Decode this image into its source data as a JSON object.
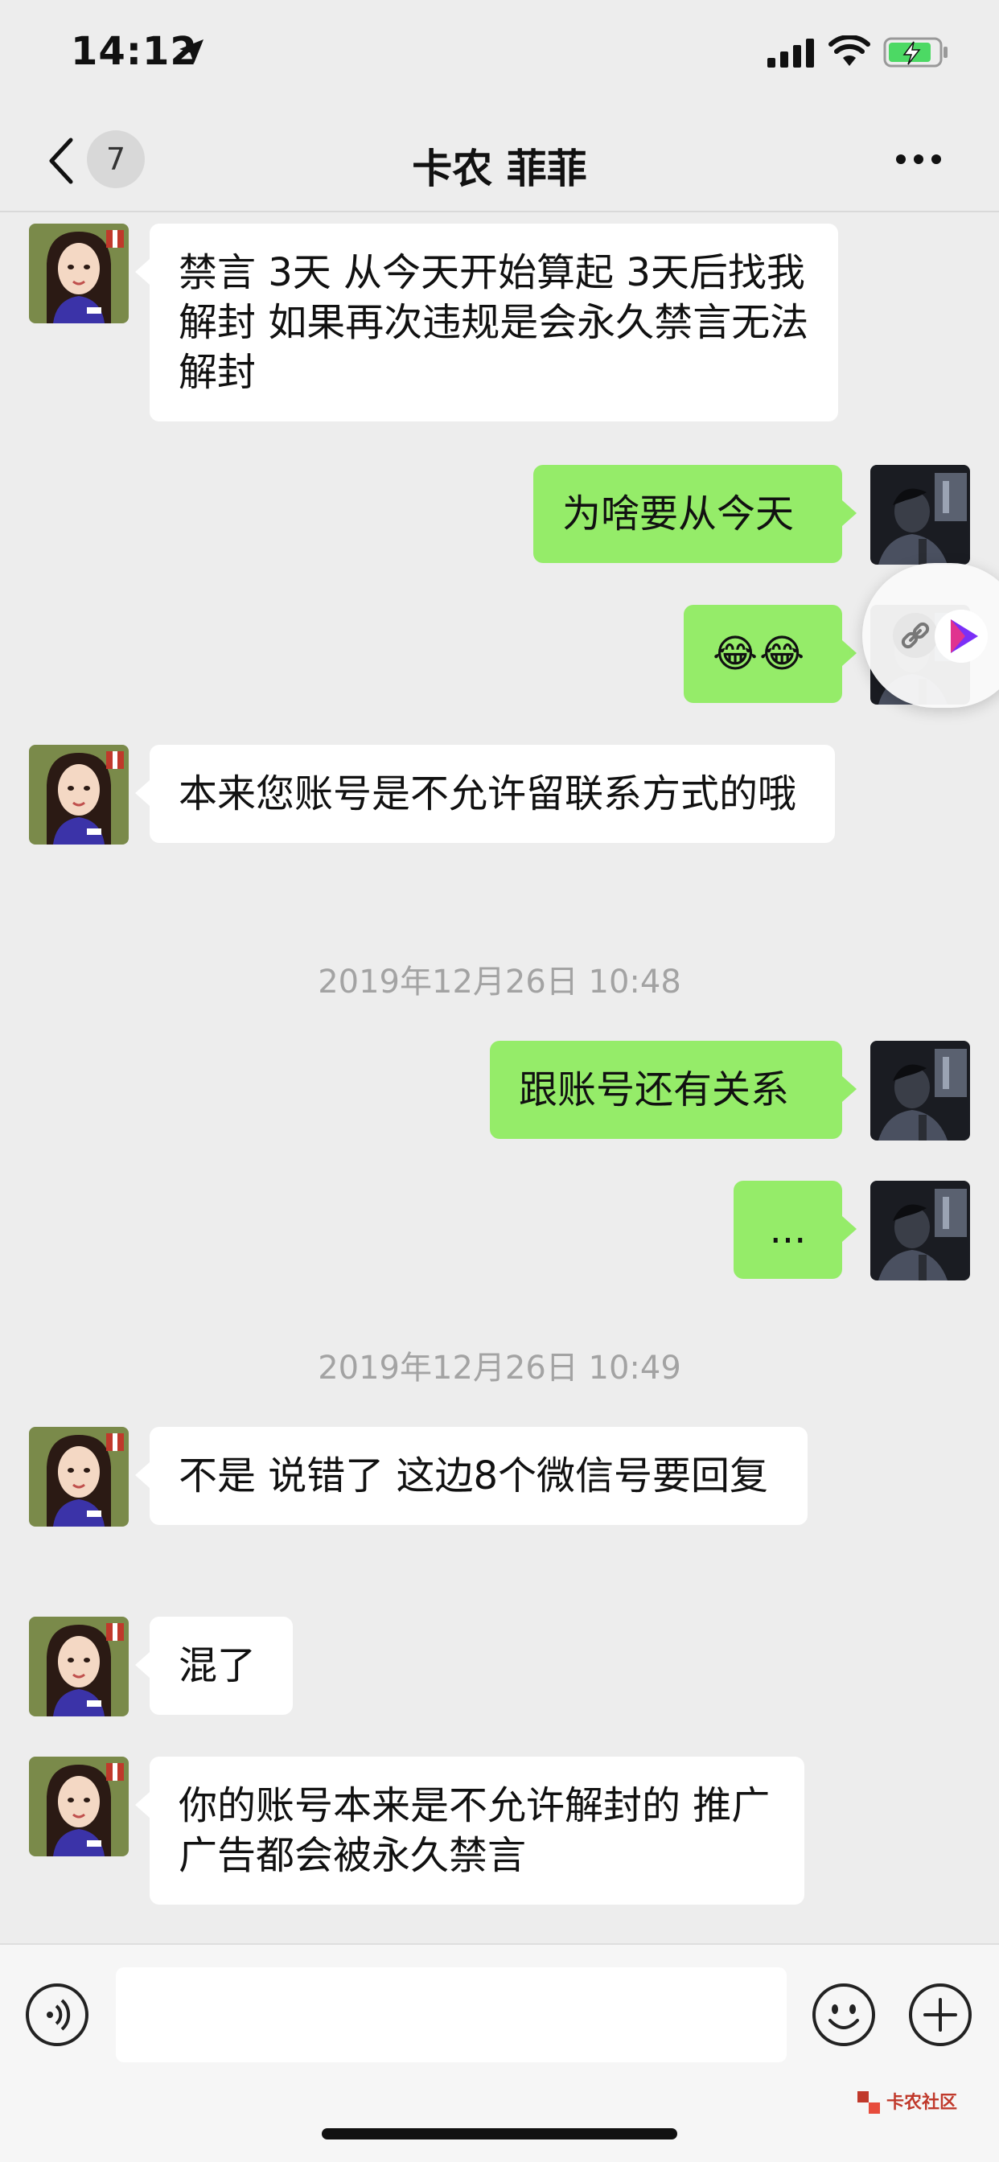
{
  "status_bar": {
    "time": "14:12",
    "icons": [
      "location-arrow-icon",
      "cellular-signal-icon",
      "wifi-icon",
      "battery-charging-icon"
    ]
  },
  "nav": {
    "unread_count": "7",
    "title": "卡农 菲菲"
  },
  "messages": [
    {
      "side": "in",
      "text": "禁言 3天 从今天开始算起 3天后找我解封 如果再次违规是会永久禁言无法解封"
    },
    {
      "side": "out",
      "text": "为啥要从今天"
    },
    {
      "side": "out",
      "text": "😂😂"
    },
    {
      "side": "in",
      "text": "本来您账号是不允许留联系方式的哦"
    },
    {
      "type": "timestamp",
      "text": "2019年12月26日 10:48"
    },
    {
      "side": "out",
      "text": "跟账号还有关系"
    },
    {
      "side": "out",
      "text": "..."
    },
    {
      "type": "timestamp",
      "text": "2019年12月26日 10:49"
    },
    {
      "side": "in",
      "text": "不是 说错了 这边8个微信号要回复"
    },
    {
      "side": "in",
      "text": "混了"
    },
    {
      "side": "in",
      "text": "你的账号本来是不允许解封的 推广广告都会被永久禁言"
    }
  ],
  "input": {
    "placeholder": "",
    "value": ""
  },
  "watermark": {
    "text": "卡农社区"
  },
  "colors": {
    "background": "#ededed",
    "outgoing_bubble": "#95ec69",
    "incoming_bubble": "#ffffff",
    "timestamp_text": "#a3a3a3"
  }
}
